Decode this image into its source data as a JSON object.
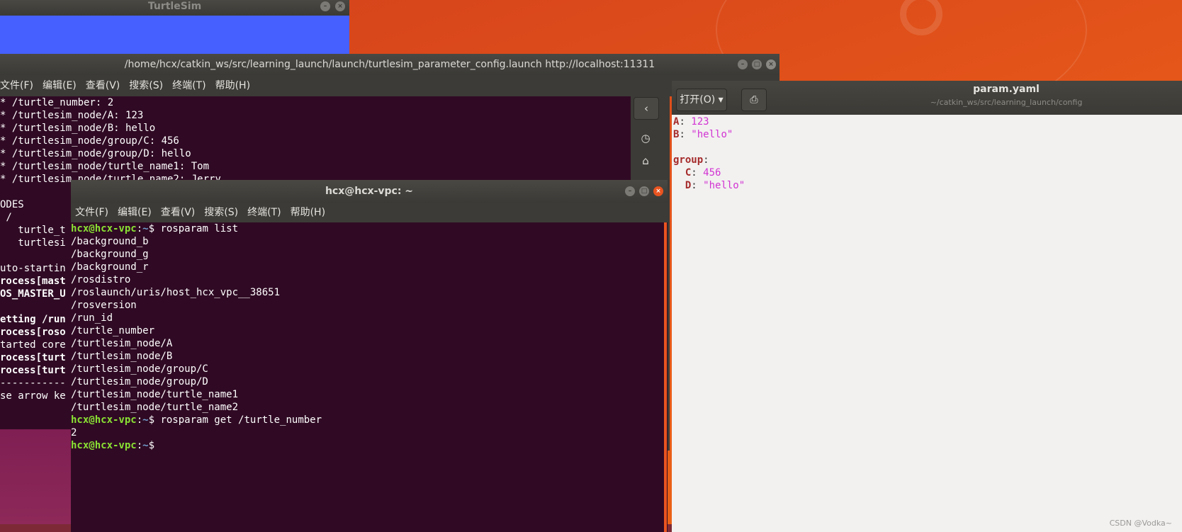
{
  "colors": {
    "terminal_bg": "#300a24",
    "prompt_user": "#8ae234",
    "prompt_path": "#729fcf",
    "accent": "#e95420",
    "turtlesim_bg": "#4560ff"
  },
  "turtlesim": {
    "title": "TurtleSim"
  },
  "launch_terminal": {
    "title": "/home/hcx/catkin_ws/src/learning_launch/launch/turtlesim_parameter_config.launch http://localhost:11311",
    "menu": [
      "文件(F)",
      "编辑(E)",
      "查看(V)",
      "搜索(S)",
      "终端(T)",
      "帮助(H)"
    ],
    "lines": [
      "* /turtle_number: 2",
      "* /turtlesim_node/A: 123",
      "* /turtlesim_node/B: hello",
      "* /turtlesim_node/group/C: 456",
      "* /turtlesim_node/group/D: hello",
      "* /turtlesim_node/turtle_name1: Tom",
      "* /turtlesim_node/turtle_name2: Jerry",
      "",
      "ODES",
      " /",
      "   turtle_t",
      "   turtlesi",
      "",
      "uto-startin",
      "rocess[mast",
      "OS_MASTER_U",
      "",
      "etting /run",
      "rocess[roso",
      "tarted core",
      "rocess[turt",
      "rocess[turt",
      "-----------",
      "se arrow ke"
    ]
  },
  "file_sidebar": {
    "back": "‹",
    "recent": "◷",
    "home": "⌂"
  },
  "gedit": {
    "open_label": "打开(O) ▾",
    "extra_label": "⎙",
    "title": "param.yaml",
    "path": "~/catkin_ws/src/learning_launch/config",
    "lines": [
      {
        "key": "A",
        "val": "123",
        "indent": ""
      },
      {
        "key": "B",
        "val": "\"hello\"",
        "indent": ""
      },
      {
        "key": "",
        "val": "",
        "indent": ""
      },
      {
        "key": "group",
        "val": "",
        "indent": ""
      },
      {
        "key": "C",
        "val": "456",
        "indent": "  "
      },
      {
        "key": "D",
        "val": "\"hello\"",
        "indent": "  "
      }
    ]
  },
  "front_terminal": {
    "title": "hcx@hcx-vpc: ~",
    "menu": [
      "文件(F)",
      "编辑(E)",
      "查看(V)",
      "搜索(S)",
      "终端(T)",
      "帮助(H)"
    ],
    "prompt_user": "hcx@hcx-vpc",
    "prompt_path": "~",
    "command1": "rosparam list",
    "list_output": [
      "/background_b",
      "/background_g",
      "/background_r",
      "/rosdistro",
      "/roslaunch/uris/host_hcx_vpc__38651",
      "/rosversion",
      "/run_id",
      "/turtle_number",
      "/turtlesim_node/A",
      "/turtlesim_node/B",
      "/turtlesim_node/group/C",
      "/turtlesim_node/group/D",
      "/turtlesim_node/turtle_name1",
      "/turtlesim_node/turtle_name2"
    ],
    "command2": "rosparam get /turtle_number",
    "output2": "2"
  },
  "watermark": "CSDN @Vodka~"
}
